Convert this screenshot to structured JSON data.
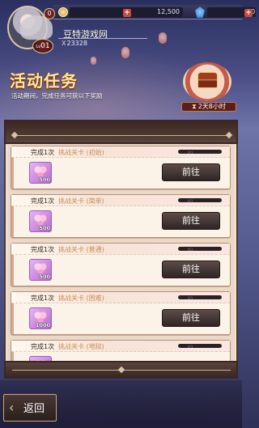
{
  "header": {
    "gold_value": "12,500",
    "gem_value": "10",
    "plus_label": "+",
    "level_badge": "0",
    "vip_level": "01",
    "vip_prefix": "Lv",
    "player_name": "豆特游戏网",
    "player_id_prefix": "X",
    "player_id": "23328"
  },
  "event": {
    "title": "活动任务",
    "description": "活动期间，完成任务可获以下奖励",
    "timer_icon": "hourglass-icon",
    "timer": "2天8小时"
  },
  "quests": [
    {
      "complete": "完成1次",
      "challenge": "挑战关卡 (初始)",
      "progress": "0/1",
      "reward_qty": "500",
      "button": "前往"
    },
    {
      "complete": "完成1次",
      "challenge": "挑战关卡 (简单)",
      "progress": "0/1",
      "reward_qty": "500",
      "button": "前往"
    },
    {
      "complete": "完成1次",
      "challenge": "挑战关卡 (普通)",
      "progress": "0/1",
      "reward_qty": "500",
      "button": "前往"
    },
    {
      "complete": "完成1次",
      "challenge": "挑战关卡 (困难)",
      "progress": "0/1",
      "reward_qty": "1000",
      "button": "前往"
    },
    {
      "complete": "完成1次",
      "challenge": "挑战关卡 (地狱)",
      "progress": "0/1",
      "reward_qty": "",
      "button": ""
    }
  ],
  "footer": {
    "back_icon": "back-arrow-icon",
    "back_label": "返回"
  },
  "colors": {
    "title_gold": "#ffe6a6",
    "button_dark": "#2f2526",
    "panel_bg": "#f1e4d4",
    "challenge_text": "#c58f5a"
  }
}
